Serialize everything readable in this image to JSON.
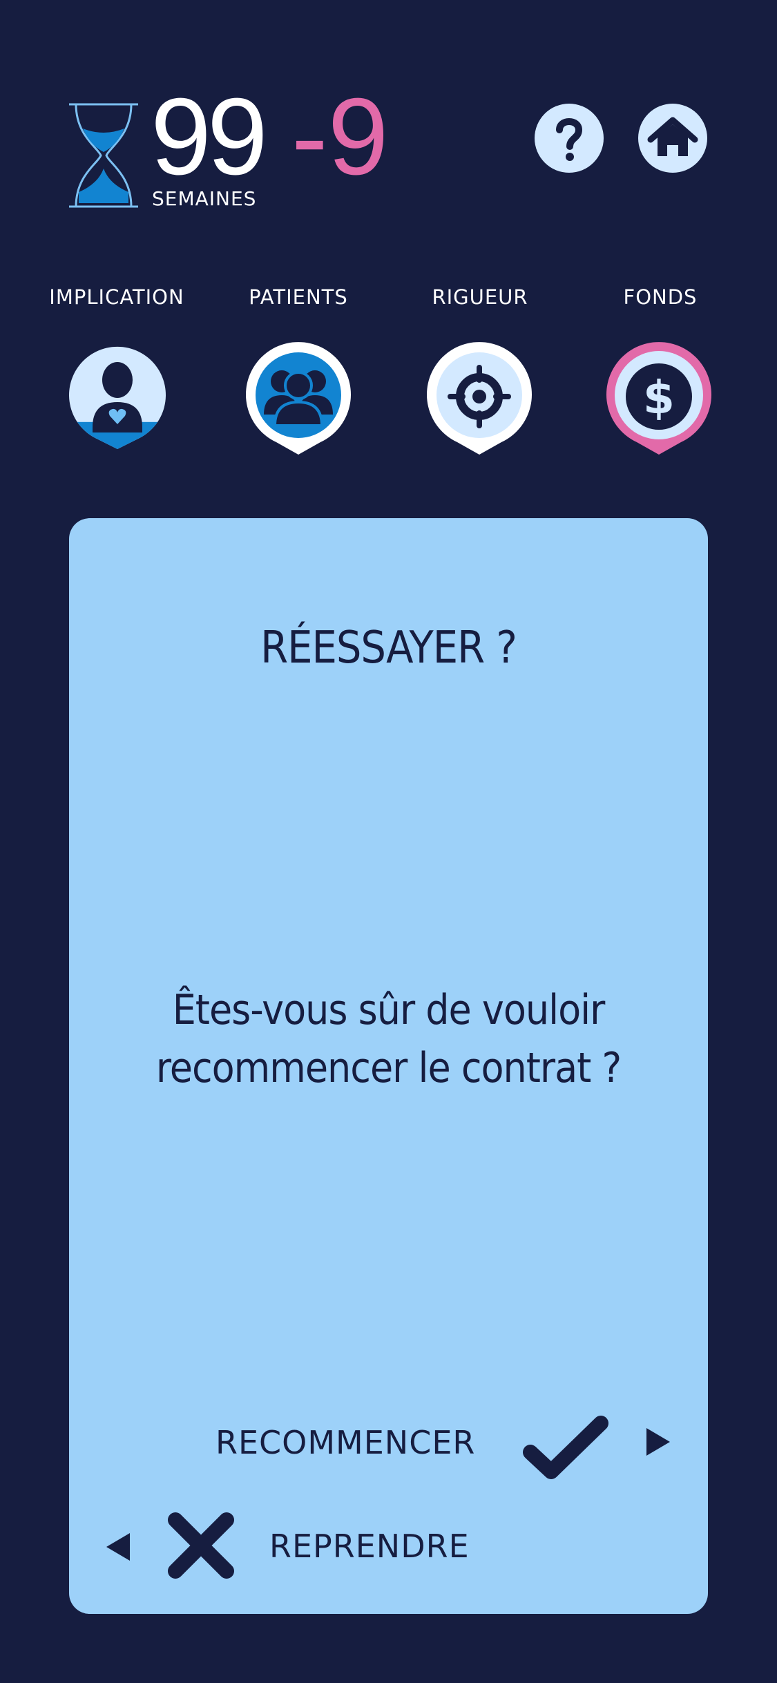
{
  "header": {
    "weeks_remaining": "99",
    "weeks_delta": "-9",
    "weeks_unit": "SEMAINES",
    "icons": {
      "timer": "hourglass-icon",
      "help": "question-icon",
      "home": "home-icon"
    }
  },
  "stats": [
    {
      "label": "IMPLICATION",
      "icon": "person-heart-icon",
      "level": 0.28,
      "state": "normal"
    },
    {
      "label": "PATIENTS",
      "icon": "group-icon",
      "level": 1.0,
      "state": "selected"
    },
    {
      "label": "RIGUEUR",
      "icon": "crosshair-icon",
      "level": 0.0,
      "state": "selected"
    },
    {
      "label": "FONDS",
      "icon": "dollar-icon",
      "level": 0.0,
      "state": "warning"
    }
  ],
  "dialog": {
    "title": "RÉESSAYER ?",
    "message": "Êtes-vous sûr de vouloir recommencer le contrat ?",
    "confirm": {
      "label": "RECOMMENCER",
      "icon": "check-icon",
      "arrow": "arrow-right-icon"
    },
    "cancel": {
      "label": "REPRENDRE",
      "icon": "x-icon",
      "arrow": "arrow-left-icon"
    }
  },
  "colors": {
    "background": "#161d40",
    "card": "#9dd1f9",
    "icon_light": "#d3e9ff",
    "accent_blue": "#1284d1",
    "accent_pink": "#e26aa9",
    "ink": "#161d40"
  }
}
